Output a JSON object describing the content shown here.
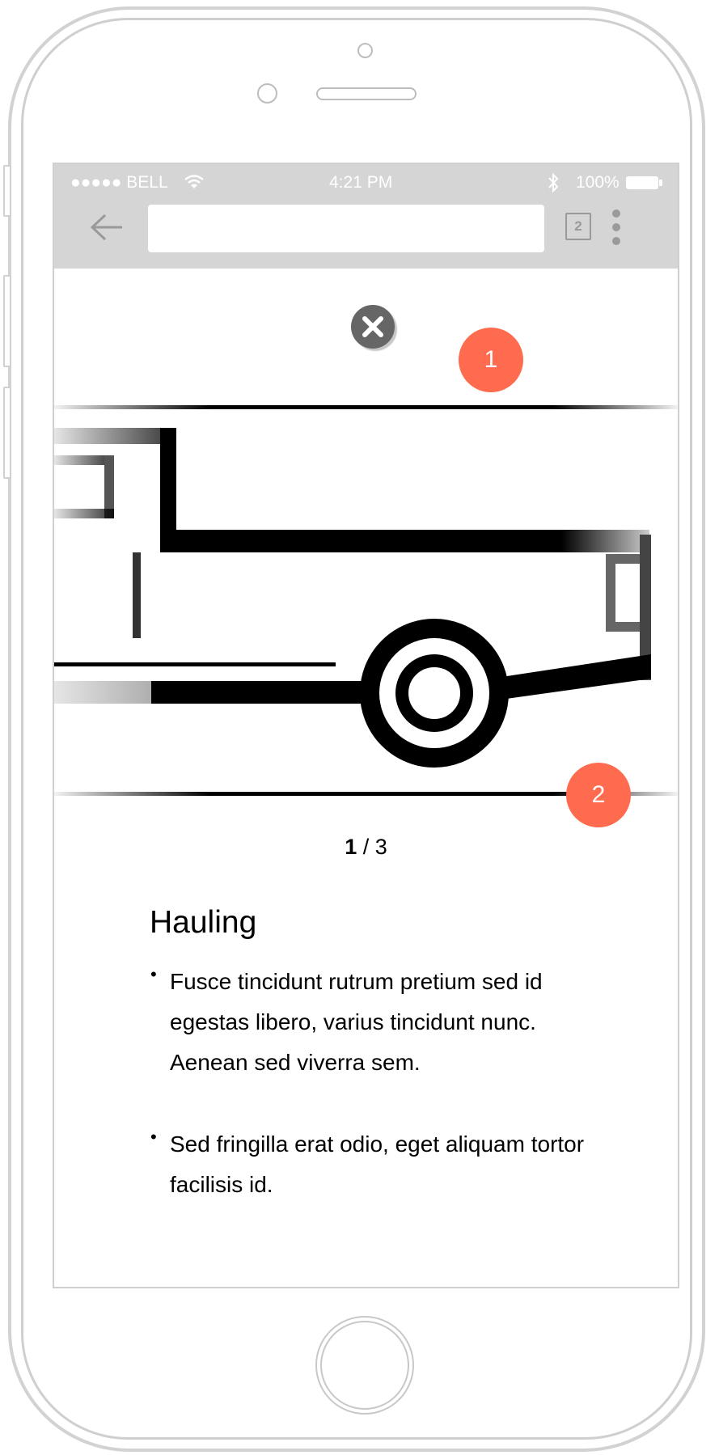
{
  "status_bar": {
    "signal": "●●●●● BELL",
    "time": "4:21 PM",
    "battery": "100%"
  },
  "browser": {
    "url_value": "",
    "tab_count": "2"
  },
  "annotations": [
    "1",
    "2"
  ],
  "gallery": {
    "current": "1",
    "separator": " / ",
    "total": "3"
  },
  "content": {
    "title": "Hauling",
    "bullets": [
      "Fusce tincidunt rutrum pretium sed id egestas libero, varius tincidunt nunc. Aenean sed viverra sem.",
      "Sed fringilla erat odio, eget aliquam tortor facilisis id."
    ]
  },
  "colors": {
    "accent_badge": "#ff6b4f",
    "toolbar": "#d5d5d5",
    "close_button": "#666666"
  }
}
